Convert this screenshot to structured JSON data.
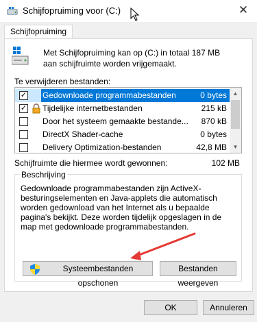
{
  "window": {
    "title": "Schijfopruiming voor  (C:)",
    "close_glyph": "✕"
  },
  "tabs": [
    {
      "label": "Schijfopruiming"
    }
  ],
  "info_text": "Met Schijfopruiming kan op  (C:) in totaal 187 MB aan schijfruimte worden vrijgemaakt.",
  "list": {
    "label": "Te verwijderen bestanden:",
    "items": [
      {
        "name": "Gedownloade programmabestanden",
        "size": "0 bytes",
        "checked": true,
        "selected": true,
        "icon": "none"
      },
      {
        "name": "Tijdelijke internetbestanden",
        "size": "215 kB",
        "checked": true,
        "selected": false,
        "icon": "lock-icon"
      },
      {
        "name": "Door het systeem gemaakte bestande...",
        "size": "870 kB",
        "checked": false,
        "selected": false,
        "icon": "none"
      },
      {
        "name": "DirectX Shader-cache",
        "size": "0 bytes",
        "checked": false,
        "selected": false,
        "icon": "none"
      },
      {
        "name": "Delivery Optimization-bestanden",
        "size": "42,8 MB",
        "checked": false,
        "selected": false,
        "icon": "none"
      }
    ]
  },
  "gain": {
    "label": "Schijfruimte die hiermee wordt gewonnen:",
    "value": "102 MB"
  },
  "description": {
    "title": "Beschrijving",
    "text": "Gedownloade programmabestanden zijn ActiveX-besturingselementen en Java-applets die automatisch worden gedownload van het Internet als u bepaalde pagina's bekijkt. Deze worden tijdelijk opgeslagen in de map met gedownloade programmabestanden."
  },
  "buttons": {
    "clean_system": "Systeembestanden opschonen",
    "view_files": "Bestanden weergeven",
    "ok": "OK",
    "cancel": "Annuleren"
  },
  "colors": {
    "selection": "#0078d7",
    "arrow": "#e53935"
  }
}
